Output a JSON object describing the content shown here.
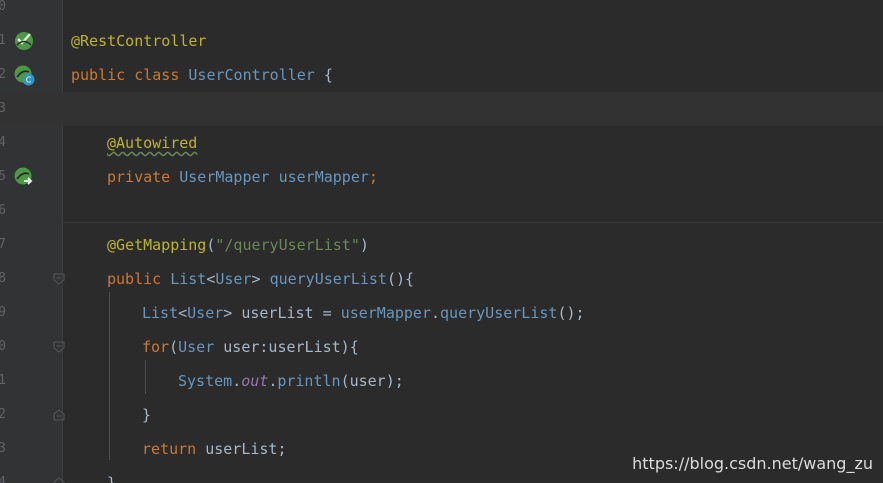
{
  "colors": {
    "background": "#2b2b2b",
    "gutter": "#313335",
    "keyword": "#cc7832",
    "annotation": "#bbb529",
    "type": "#6897bb",
    "string": "#6a8759",
    "static_field": "#9876aa",
    "text": "#a9b7c6",
    "gutter_icon_green": "#4b9a43"
  },
  "editor": {
    "line_numbers": [
      "0",
      "1",
      "2",
      "3",
      "4",
      "5",
      "6",
      "7",
      "8",
      "9",
      "0",
      "1",
      "2",
      "3",
      "4"
    ],
    "lines": {
      "l1": {
        "ann": "@RestController"
      },
      "l2": {
        "kw_public": "public",
        "kw_class": "class",
        "cls": "UserController",
        "brace": "{"
      },
      "l4": {
        "ann": "@Autowired"
      },
      "l5": {
        "kw_private": "private",
        "type": "UserMapper",
        "name": "userMapper",
        "semi": ";"
      },
      "l7": {
        "ann": "@GetMapping",
        "paren_open": "(",
        "str": "\"/queryUserList\"",
        "paren_close": ")"
      },
      "l8": {
        "kw_public": "public",
        "type": "List",
        "lt": "<",
        "generic": "User",
        "gt": ">",
        "fn": "queryUserList",
        "tail": "(){"
      },
      "l9": {
        "type": "List",
        "lt": "<",
        "generic": "User",
        "gt": ">",
        "var": "userList",
        "eq": "=",
        "obj": "userMapper",
        "dot": ".",
        "fn": "queryUserList",
        "tail": "();"
      },
      "l10": {
        "kw_for": "for",
        "paren": "(",
        "type": "User",
        "rest": "user:userList){"
      },
      "l11": {
        "cls": "System",
        "dot1": ".",
        "field": "out",
        "dot2": ".",
        "fn": "println",
        "tail": "(user);"
      },
      "l12": {
        "brace": "}"
      },
      "l13": {
        "kw_return": "return",
        "rest": "userList;"
      },
      "l14": {
        "brace": "}"
      }
    },
    "gutter_icons": {
      "line1": "bean-checkmark-icon",
      "line2": "spring-bean-class-icon",
      "line5": "autowired-navigate-icon"
    }
  },
  "watermark": "https://blog.csdn.net/wang_zu"
}
